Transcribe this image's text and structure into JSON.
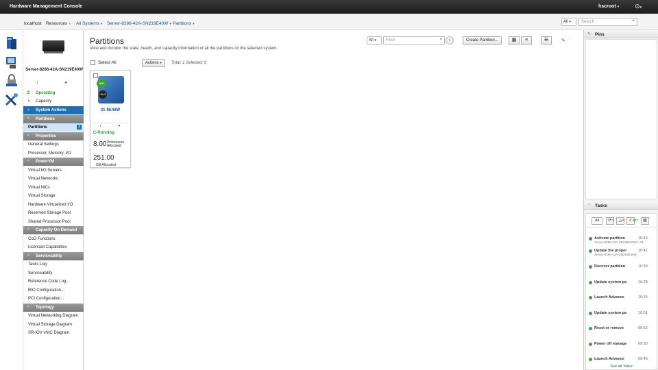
{
  "header": {
    "app_title": "Hardware Management Console",
    "user": "hscroot",
    "help_icon": "help-icon"
  },
  "breadcrumb": {
    "items": [
      {
        "label": "localhost",
        "link": false
      },
      {
        "label": "Resources",
        "link": false
      },
      {
        "label": "All Systems",
        "link": true
      },
      {
        "label": "Server-8286-42A-SN219E40W",
        "link": true
      },
      {
        "label": "Partitions",
        "link": true
      }
    ]
  },
  "search": {
    "scope": "All",
    "placeholder": "Search"
  },
  "rail": {
    "icons": [
      "resources-icon",
      "systems-icon",
      "security-icon",
      "hmc-management-icon"
    ]
  },
  "nav": {
    "server_name": "Server-8286-42A-SN219E40W",
    "status": "Operating",
    "capacity": "Capacity",
    "system_actions": "System Actions",
    "sections": [
      {
        "head": "Partitions",
        "items": [
          {
            "label": "Partitions",
            "badge": "1"
          }
        ]
      },
      {
        "head": "Properties",
        "items": [
          {
            "label": "General Settings"
          },
          {
            "label": "Processor, Memory, I/O"
          }
        ]
      },
      {
        "head": "PowerVM",
        "items": [
          {
            "label": "Virtual I/O Servers"
          },
          {
            "label": "Virtual Networks"
          },
          {
            "label": "Virtual NICs"
          },
          {
            "label": "Virtual Storage"
          },
          {
            "label": "Hardware Virtualized I/O"
          },
          {
            "label": "Reserved Storage Pool"
          },
          {
            "label": "Shared Processor Pool"
          }
        ]
      },
      {
        "head": "Capacity On Demand",
        "items": [
          {
            "label": "CoD Functions"
          },
          {
            "label": "Licensed Capabilities"
          }
        ]
      },
      {
        "head": "Serviceability",
        "items": [
          {
            "label": "Tasks Log"
          },
          {
            "label": "Serviceability"
          },
          {
            "label": "Reference Code Log..."
          },
          {
            "label": "RIO Configuration..."
          },
          {
            "label": "PCI Configuration..."
          }
        ]
      },
      {
        "head": "Topology",
        "items": [
          {
            "label": "Virtual Networking Diagram"
          },
          {
            "label": "Virtual Storage Diagram"
          },
          {
            "label": "SR-IOV vNIC Diagram"
          }
        ]
      }
    ]
  },
  "main": {
    "title": "Partitions",
    "description": "View and monitor the state, health, and capacity information of all the partitions on the selected system.",
    "filter_scope": "All",
    "filter_placeholder": "Filter",
    "create_button": "Create Partition...",
    "select_all": "Select All",
    "actions": "Actions",
    "total": "Total: 1 Selected: 0"
  },
  "partition_card": {
    "name": "21-9E40W",
    "os_badge_top": "AIX",
    "os_badge_bottom": "LINUX",
    "status": "Running",
    "processors_value": "8.00",
    "processors_label": "Processors Allocated",
    "memory_value": "251.00",
    "memory_label": "GB Allocated"
  },
  "pins": {
    "title": "Pins"
  },
  "tasks": {
    "title": "Tasks",
    "all": "All",
    "counts": {
      "running": "1",
      "warning": "0",
      "completed": "267"
    },
    "items": [
      {
        "name": "Activate partition",
        "time": "10:43",
        "sub": "Server-8286-42A-SN219E40W > 21-9E40W"
      },
      {
        "name": "Update the proper",
        "time": "10:41",
        "sub": "Server-8286-42A-SN219E40W"
      },
      {
        "name": "Recover partition",
        "time": "10:39",
        "sub": ""
      },
      {
        "name": "Update system pa",
        "time": "10:28",
        "sub": ""
      },
      {
        "name": "Launch Advance",
        "time": "10:24",
        "sub": ""
      },
      {
        "name": "Update system pa",
        "time": "10:01",
        "sub": ""
      },
      {
        "name": "Reset or remove",
        "time": "09:52",
        "sub": ""
      },
      {
        "name": "Power off manage",
        "time": "09:50",
        "sub": ""
      },
      {
        "name": "Launch Advance",
        "time": "09:46",
        "sub": ""
      }
    ],
    "see_all": "See all Tasks"
  }
}
